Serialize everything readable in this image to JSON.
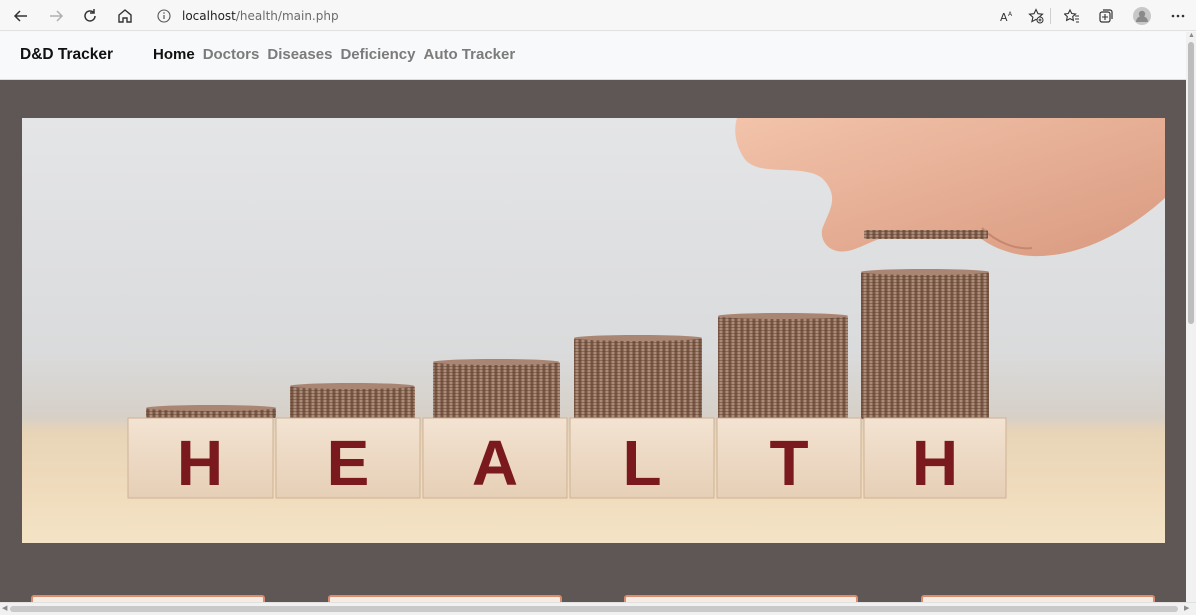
{
  "browser": {
    "url_host": "localhost",
    "url_path": "/health/main.php",
    "icons": [
      "back-arrow-icon",
      "forward-arrow-icon",
      "reload-icon",
      "home-icon",
      "info-icon",
      "read-aloud-icon",
      "add-favorite-icon",
      "favorites-icon",
      "collections-icon",
      "profile-icon",
      "more-icon"
    ]
  },
  "navbar": {
    "brand": "D&D Tracker",
    "links": [
      {
        "label": "Home",
        "active": true
      },
      {
        "label": "Doctors",
        "active": false
      },
      {
        "label": "Diseases",
        "active": false
      },
      {
        "label": "Deficiency",
        "active": false
      },
      {
        "label": "Auto Tracker",
        "active": false
      }
    ]
  },
  "hero": {
    "letters": [
      "H",
      "E",
      "A",
      "L",
      "T",
      "H"
    ],
    "letter_color": "#7a1a1f"
  },
  "colors": {
    "page_bg": "#5f5656",
    "nav_bg": "#f8f9fa",
    "card_border": "#d98c6e"
  }
}
